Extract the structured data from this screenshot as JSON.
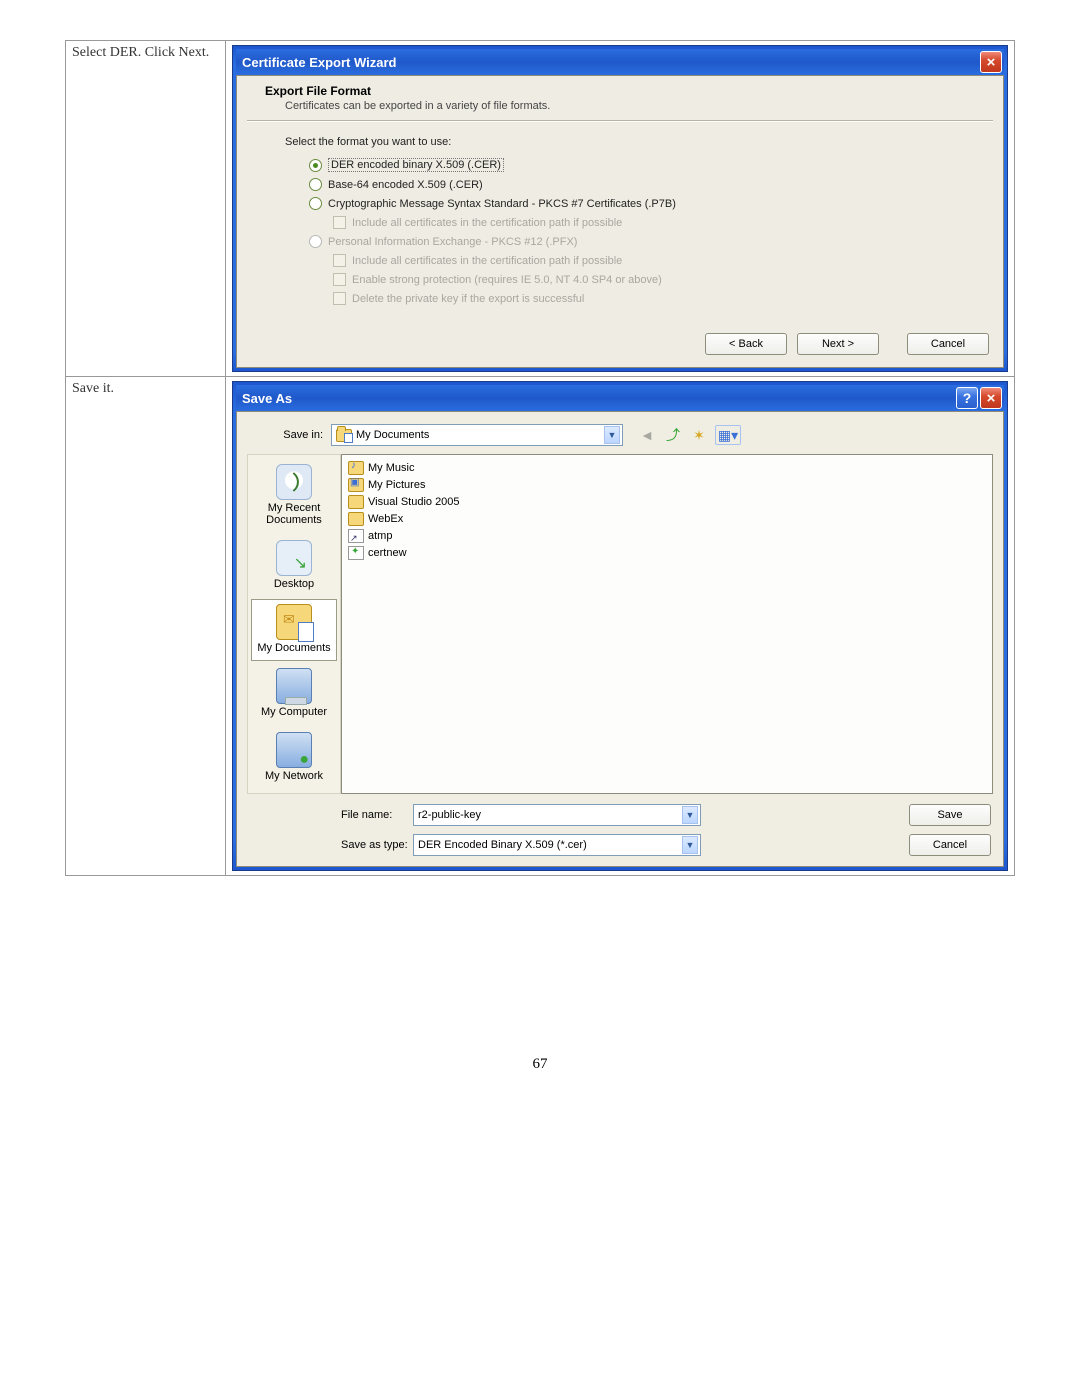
{
  "page_number": "67",
  "row1": {
    "desc": "Select DER.  Click Next.",
    "dialog_title": "Certificate Export Wizard",
    "header_title": "Export File Format",
    "header_sub": "Certificates can be exported in a variety of file formats.",
    "prompt": "Select the format you want to use:",
    "options": {
      "der": "DER encoded binary X.509 (.CER)",
      "b64": "Base-64 encoded X.509 (.CER)",
      "p7b": "Cryptographic Message Syntax Standard - PKCS #7 Certificates (.P7B)",
      "p7b_chk": "Include all certificates in the certification path if possible",
      "pfx": "Personal Information Exchange - PKCS #12 (.PFX)",
      "pfx_chk1": "Include all certificates in the certification path if possible",
      "pfx_chk2": "Enable strong protection (requires IE 5.0, NT 4.0 SP4 or above)",
      "pfx_chk3": "Delete the private key if the export is successful"
    },
    "buttons": {
      "back": "< Back",
      "next": "Next >",
      "cancel": "Cancel"
    }
  },
  "row2": {
    "desc": "Save it.",
    "dialog_title": "Save As",
    "savein_label": "Save in:",
    "savein_value": "My Documents",
    "places": {
      "recent": "My Recent Documents",
      "desktop": "Desktop",
      "mydocs": "My Documents",
      "computer": "My Computer",
      "network": "My Network"
    },
    "files": {
      "f1": "My Music",
      "f2": "My Pictures",
      "f3": "Visual Studio 2005",
      "f4": "WebEx",
      "f5": "atmp",
      "f6": "certnew"
    },
    "filename_label": "File name:",
    "filename_value": "r2-public-key",
    "filetype_label": "Save as type:",
    "filetype_value": "DER Encoded Binary X.509 (*.cer)",
    "buttons": {
      "save": "Save",
      "cancel": "Cancel"
    }
  }
}
